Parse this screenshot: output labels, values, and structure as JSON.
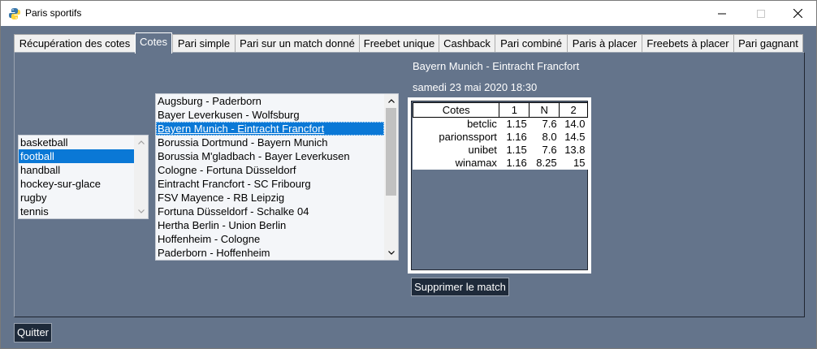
{
  "window": {
    "title": "Paris sportifs"
  },
  "tabs": [
    {
      "label": "Récupération des cotes"
    },
    {
      "label": "Cotes"
    },
    {
      "label": "Pari simple"
    },
    {
      "label": "Pari sur un match donné"
    },
    {
      "label": "Freebet unique"
    },
    {
      "label": "Cashback"
    },
    {
      "label": "Pari combiné"
    },
    {
      "label": "Paris à placer"
    },
    {
      "label": "Freebets à placer"
    },
    {
      "label": "Pari gagnant"
    }
  ],
  "selected_tab": "Cotes",
  "sports": [
    "basketball",
    "football",
    "handball",
    "hockey-sur-glace",
    "rugby",
    "tennis"
  ],
  "selected_sport": "football",
  "matches": [
    "Augsburg - Paderborn",
    "Bayer Leverkusen - Wolfsburg",
    "Bayern Munich - Eintracht Francfort",
    "Borussia Dortmund - Bayern Munich",
    "Borussia M'gladbach - Bayer Leverkusen",
    "Cologne - Fortuna Düsseldorf",
    "Eintracht Francfort - SC Fribourg",
    "FSV Mayence - RB Leipzig",
    "Fortuna Düsseldorf - Schalke 04",
    "Hertha Berlin - Union Berlin",
    "Hoffenheim - Cologne",
    "Paderborn - Hoffenheim"
  ],
  "selected_match": "Bayern Munich - Eintracht Francfort",
  "match_title": "Bayern Munich - Eintracht Francfort",
  "match_date": "samedi 23 mai 2020 18:30",
  "odds_table": {
    "headers": [
      "Cotes",
      "1",
      "N",
      "2"
    ],
    "rows": [
      {
        "site": "betclic",
        "one": "1.15",
        "draw": "7.6",
        "two": "14.0"
      },
      {
        "site": "parionssport",
        "one": "1.16",
        "draw": "8.0",
        "two": "14.5"
      },
      {
        "site": "unibet",
        "one": "1.15",
        "draw": "7.6",
        "two": "13.8"
      },
      {
        "site": "winamax",
        "one": "1.16",
        "draw": "8.25",
        "two": "15"
      }
    ]
  },
  "buttons": {
    "delete_match": "Supprimer le match",
    "quit": "Quitter"
  },
  "colors": {
    "background": "#64748b",
    "selection": "#0a78d6",
    "button": "#1e2a3a"
  }
}
